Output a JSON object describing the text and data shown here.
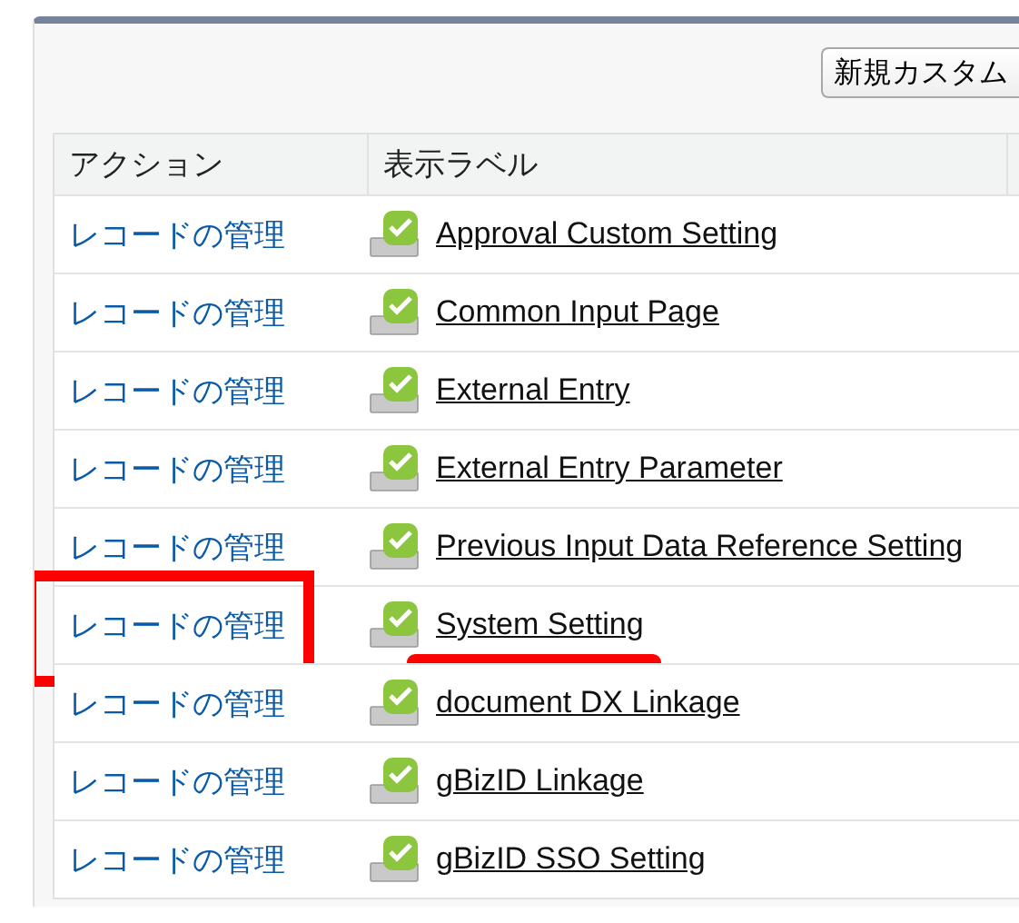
{
  "toolbar": {
    "button": "新規カスタム"
  },
  "table": {
    "columns": [
      "アクション",
      "表示ラベル"
    ],
    "rows": [
      {
        "action": "レコードの管理",
        "label": "Approval Custom Setting",
        "boxed": false,
        "underlined": false
      },
      {
        "action": "レコードの管理",
        "label": "Common Input Page",
        "boxed": false,
        "underlined": false
      },
      {
        "action": "レコードの管理",
        "label": "External Entry",
        "boxed": false,
        "underlined": false
      },
      {
        "action": "レコードの管理",
        "label": "External Entry Parameter",
        "boxed": false,
        "underlined": false
      },
      {
        "action": "レコードの管理",
        "label": "Previous Input Data Reference Setting",
        "boxed": false,
        "underlined": false
      },
      {
        "action": "レコードの管理",
        "label": "System Setting",
        "boxed": true,
        "underlined": true
      },
      {
        "action": "レコードの管理",
        "label": "document DX Linkage",
        "boxed": false,
        "underlined": false
      },
      {
        "action": "レコードの管理",
        "label": "gBizID Linkage",
        "boxed": false,
        "underlined": false
      },
      {
        "action": "レコードの管理",
        "label": "gBizID SSO Setting",
        "boxed": false,
        "underlined": false
      }
    ]
  }
}
